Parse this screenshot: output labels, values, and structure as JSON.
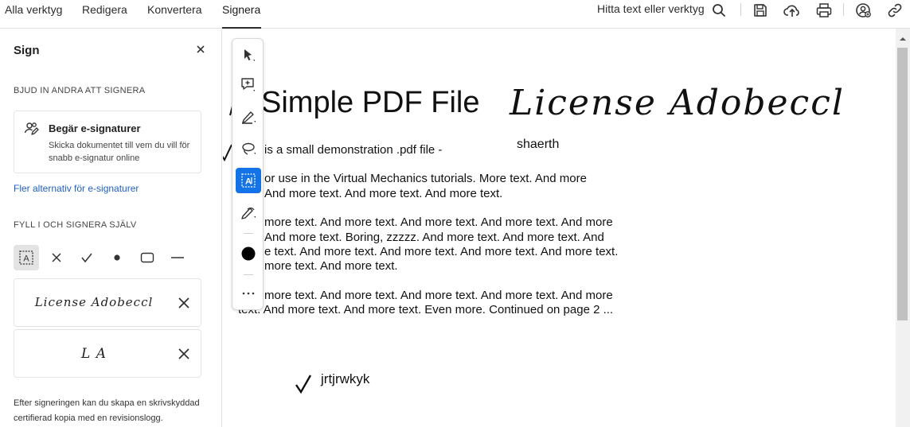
{
  "tabs": [
    {
      "label": "Alla verktyg"
    },
    {
      "label": "Redigera"
    },
    {
      "label": "Konvertera"
    },
    {
      "label": "Signera"
    }
  ],
  "toolbar": {
    "search_label": "Hitta text eller verktyg",
    "icons": [
      "search-icon",
      "save-icon",
      "cloud-upload-icon",
      "print-icon",
      "share-user-icon",
      "link-icon"
    ]
  },
  "panel": {
    "title": "Sign",
    "invite_section": "BJUD IN ANDRA ATT SIGNERA",
    "esign_title": "Begär e-signaturer",
    "esign_desc": "Skicka dokumentet till vem du vill för snabb e-signatur online",
    "more_link": "Fler alternativ för e-signaturer",
    "self_section": "FYLL I OCH SIGNERA SJÄLV",
    "tools": [
      "text-field-icon",
      "cross-icon",
      "checkmark-icon",
      "dot-icon",
      "rectangle-icon",
      "line-icon"
    ],
    "signatures": [
      {
        "text": "License Adobeccl"
      },
      {
        "text": "L A"
      }
    ],
    "footer": "Efter signeringen kan du skapa en skrivskyddad certifierad kopia med en revisionslogg."
  },
  "document": {
    "title": "Simple PDF File",
    "signature": "License Adobeccl",
    "signature_sub": "shaerth",
    "para1": "is a small demonstration .pdf file -",
    "para2_l1": "or use in the Virtual Mechanics tutorials. More text. And more",
    "para2_l2": "And more text. And more text. And more text.",
    "para3_l1": "more text. And more text. And more text. And more text. And more",
    "para3_l2": "And more text. Boring, zzzzz. And more text. And more text. And",
    "para3_l3": "e text. And more text. And more text. And more text. And more text.",
    "para3_l4": "more text. And more text.",
    "para4_l1": "more text. And more text. And more text. And more text. And more",
    "para4_l2": "text. And more text. And more text. Even more. Continued on page 2 ...",
    "check_text": "jrtjrwkyk"
  },
  "palette": {
    "tools": [
      "select-arrow-icon",
      "add-comment-icon",
      "highlight-pen-icon",
      "lasso-icon",
      "text-box-icon",
      "draw-pen-icon",
      "color-dot-icon",
      "more-icon"
    ],
    "active_color": "#1473e6"
  }
}
